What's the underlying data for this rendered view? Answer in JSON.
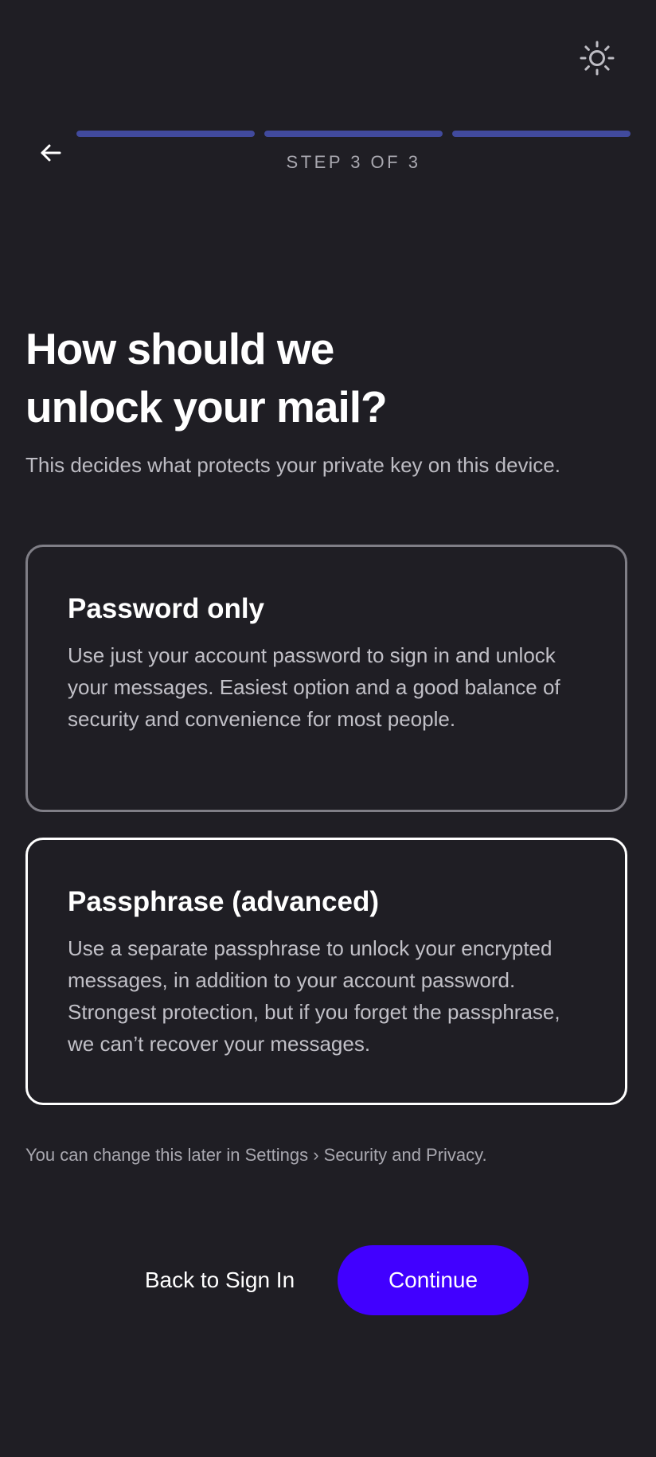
{
  "header": {
    "theme_toggle_icon": "sun-icon",
    "back_icon": "arrow-left-icon",
    "step_label": "STEP 3 OF 3",
    "progress": {
      "total_steps": 3,
      "completed_steps": 3,
      "segment_fill_fraction": [
        1,
        1,
        1
      ],
      "fill_color": "#414a9d"
    }
  },
  "main": {
    "title_lines": [
      "How should we",
      "unlock your mail?"
    ],
    "subtitle": "This decides what protects your private key on this device.",
    "options": [
      {
        "title": "Password only",
        "description": "Use just your account password to sign in and unlock your messages. Easiest option and a good balance of security and convenience for most people."
      },
      {
        "title": "Passphrase (advanced)",
        "description": "Use a separate passphrase to unlock your encrypted messages, in addition to your account password. Strongest protection, but if you forget the passphrase, we can’t recover your messages."
      }
    ],
    "footnote": "You can change this later in Settings › Security and Privacy."
  },
  "footer": {
    "back_label": "Back to Sign In",
    "continue_label": "Continue",
    "primary_color": "#4100ff"
  },
  "colors": {
    "background": "#1f1e24",
    "selected_border": "#ffffff",
    "unselected_border": "#7f7e86"
  }
}
